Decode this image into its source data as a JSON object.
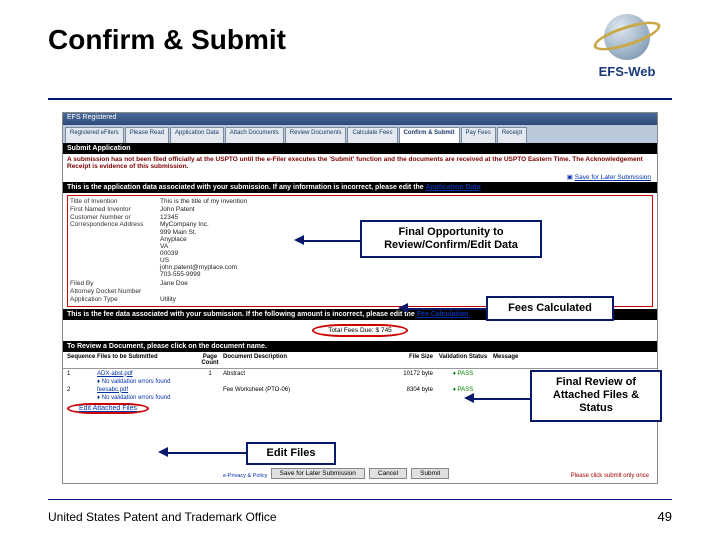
{
  "title": "Confirm & Submit",
  "logo_text": "EFS-Web",
  "app": {
    "window_title": "EFS Registered",
    "tabs": [
      "Registered eFilers",
      "Please Read",
      "Application Data",
      "Attach Documents",
      "Review Documents",
      "Calculate Fees",
      "Confirm & Submit",
      "Pay Fees",
      "Receipt"
    ],
    "submit_heading": "Submit Application",
    "submit_warning": "A submission has not been filed officially at the USPTO until the e-Filer executes the 'Submit' function and the documents are received at the USPTO Eastern Time. The Acknowledgement Receipt is evidence of this submission.",
    "save_later": "Save for Later Submission",
    "assoc_msg_text": "This is the application data associated with your submission. If any information is incorrect, please edit the ",
    "assoc_msg_link": "Application Data",
    "fields": {
      "title_label": "Title of Invention",
      "title_value": "This is the title of my invention",
      "inventor_label": "First Named Inventor",
      "inventor_value": "John Patent",
      "custno_label": "Customer Number or Correspondence Address",
      "custno_value": "12345\nMyCompany Inc.\n999 Main St.\nAnyplace\nVA\n00039\nUS\njohn.patent@myplace.com\n703-555-9999",
      "filedby_label": "Filed By",
      "filedby_value": "Jane Doe",
      "docket_label": "Attorney Docket Number",
      "docket_value": "",
      "apptype_label": "Application Type",
      "apptype_value": "Utility"
    },
    "fee_msg_text": "This is the fee data associated with your submission. If the following amount is incorrect, please edit the ",
    "fee_msg_link": "Fee Calculation",
    "fees": {
      "label": "Total Fees Due:",
      "amount": "$ 745"
    },
    "review_msg": "To Review a Document, please click on the document name.",
    "table": {
      "headers": {
        "seq": "Sequence",
        "file": "Files to be Submitted",
        "count": "Page Count",
        "desc": "Document Description",
        "size": "File Size",
        "val": "Validation Status",
        "msg": "Message"
      },
      "rows": [
        {
          "seq": "1",
          "file": "ADX-abst.pdf",
          "count": "1",
          "desc": "Abstract",
          "size": "10172 byte",
          "val": "PASS",
          "msg": ""
        },
        {
          "seq": "2",
          "file": "feesabc.pdf",
          "count": "",
          "desc": "Fee Worksheet (PTO-06)",
          "size": "8304 byte",
          "val": "PASS",
          "msg": ""
        }
      ],
      "no_errors": "No validation errors found"
    },
    "edit_link": "Edit Attached Files",
    "privacy": "e-Privacy & Policy",
    "buttons": {
      "save": "Save for Later Submission",
      "cancel": "Cancel",
      "submit": "Submit"
    },
    "submit_note": "Please click submit only once"
  },
  "callouts": {
    "review_data": "Final Opportunity to Review/Confirm/Edit Data",
    "fees": "Fees Calculated",
    "files": "Final Review of Attached Files & Status",
    "edit": "Edit Files"
  },
  "footer": {
    "org": "United States Patent and Trademark Office",
    "page": "49"
  }
}
